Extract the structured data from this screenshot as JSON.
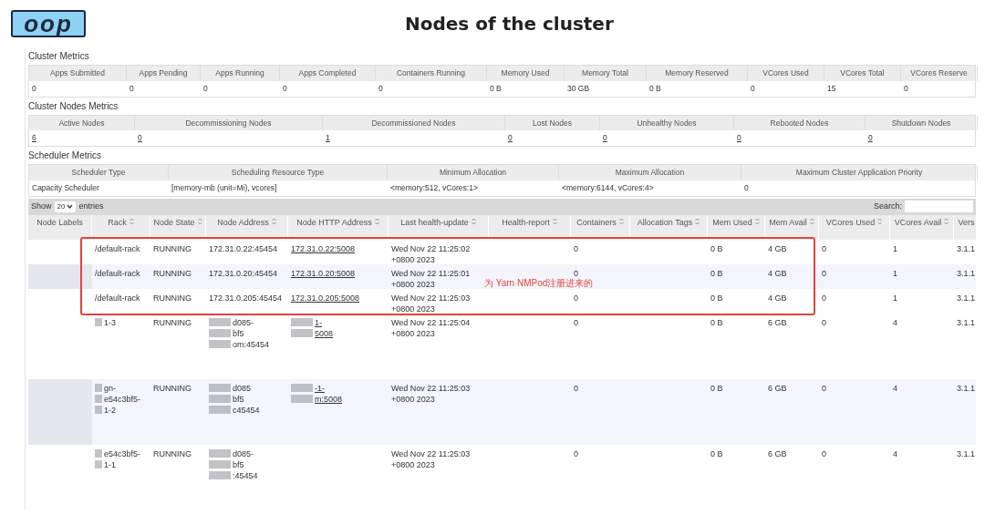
{
  "logo": {
    "text": "oop"
  },
  "title": "Nodes of the cluster",
  "sections": [
    {
      "title": "Cluster Metrics",
      "kind": "text",
      "columns": [
        "Apps Submitted",
        "Apps Pending",
        "Apps Running",
        "Apps Completed",
        "Containers Running",
        "Memory Used",
        "Memory Total",
        "Memory Reserved",
        "VCores Used",
        "VCores Total",
        "VCores Reserve"
      ],
      "values": [
        "0",
        "0",
        "0",
        "0",
        "0",
        "0 B",
        "30 GB",
        "0 B",
        "0",
        "15",
        "0"
      ]
    },
    {
      "title": "Cluster Nodes Metrics",
      "kind": "link",
      "columns": [
        "Active Nodes",
        "Decommissioning Nodes",
        "Decommissioned Nodes",
        "Lost Nodes",
        "Unhealthy Nodes",
        "Rebooted Nodes",
        "Shutdown Nodes"
      ],
      "values": [
        "6",
        "0",
        "1",
        "0",
        "0",
        "0",
        "0"
      ]
    },
    {
      "title": "Scheduler Metrics",
      "kind": "text",
      "columns": [
        "Scheduler Type",
        "Scheduling Resource Type",
        "Minimum Allocation",
        "Maximum Allocation",
        "Maximum Cluster Application Priority"
      ],
      "values": [
        "Capacity Scheduler",
        "[memory-mb (unit=Mi), vcores]",
        "<memory:512, vCores:1>",
        "<memory:6144, vCores:4>",
        "0"
      ]
    }
  ],
  "length_control": {
    "before": "Show",
    "value": "20",
    "after": "entries"
  },
  "search": {
    "label": "Search:"
  },
  "table": {
    "columns": [
      {
        "label": "Node Labels",
        "sortable": false
      },
      {
        "label": "Rack",
        "sortable": true
      },
      {
        "label": "Node State",
        "sortable": true
      },
      {
        "label": "Node Address",
        "sortable": true
      },
      {
        "label": "Node HTTP Address",
        "sortable": true
      },
      {
        "label": "Last health-update",
        "sortable": true
      },
      {
        "label": "Health-report",
        "sortable": true
      },
      {
        "label": "Containers",
        "sortable": true
      },
      {
        "label": "Allocation Tags",
        "sortable": true
      },
      {
        "label": "Mem Used",
        "sortable": true
      },
      {
        "label": "Mem Avail",
        "sortable": true
      },
      {
        "label": "VCores Used",
        "sortable": true
      },
      {
        "label": "VCores Avail",
        "sortable": true
      },
      {
        "label": "Vers",
        "sortable": false
      }
    ],
    "rows": [
      {
        "rack": "/default-rack",
        "state": "RUNNING",
        "address": "172.31.0.22:45454",
        "http": "172.31.0.22:5008",
        "update": "Wed Nov 22 11:25:02 +0800 2023",
        "containers": "0",
        "mem_used": "0 B",
        "mem_avail": "4 GB",
        "vcores_used": "0",
        "vcores_avail": "1",
        "version": "3.1.1"
      },
      {
        "rack": "/default-rack",
        "state": "RUNNING",
        "address": "172.31.0.20:45454",
        "http": "172.31.0.20:5008",
        "update": "Wed Nov 22 11:25:01 +0800 2023",
        "containers": "0",
        "mem_used": "0 B",
        "mem_avail": "4 GB",
        "vcores_used": "0",
        "vcores_avail": "1",
        "version": "3.1.1"
      },
      {
        "rack": "/default-rack",
        "state": "RUNNING",
        "address": "172.31.0.205:45454",
        "http": "172.31.0.205:5008",
        "update": "Wed Nov 22 11:25:03 +0800 2023",
        "containers": "0",
        "mem_used": "0 B",
        "mem_avail": "4 GB",
        "vcores_used": "0",
        "vcores_avail": "1",
        "version": "3.1.1"
      },
      {
        "rack": [
          "1-3"
        ],
        "state": "RUNNING",
        "address": [
          "d085-",
          "bf5",
          "om:45454"
        ],
        "http": [
          "1-",
          "5008"
        ],
        "update": "Wed Nov 22 11:25:04 +0800 2023",
        "containers": "0",
        "mem_used": "0 B",
        "mem_avail": "6 GB",
        "vcores_used": "0",
        "vcores_avail": "4",
        "version": "3.1.1"
      },
      {
        "rack": [
          "gn-",
          "e54c3bf5-",
          "1-2"
        ],
        "state": "RUNNING",
        "address": [
          "d085",
          "bf5",
          "c45454"
        ],
        "http": [
          "-1-",
          "m:5008"
        ],
        "update": "Wed Nov 22 11:25:03 +0800 2023",
        "containers": "0",
        "mem_used": "0 B",
        "mem_avail": "6 GB",
        "vcores_used": "0",
        "vcores_avail": "4",
        "version": "3.1.1"
      },
      {
        "rack": [
          "e54c3bf5-",
          "1-1"
        ],
        "state": "RUNNING",
        "address": [
          "d085-",
          "bf5",
          ":45454"
        ],
        "update": "Wed Nov 22 11:25:03 +0800 2023",
        "containers": "0",
        "mem_used": "0 B",
        "mem_avail": "6 GB",
        "vcores_used": "0",
        "vcores_avail": "4",
        "version": "3.1.1"
      }
    ]
  },
  "annotation": {
    "text": "为 Yarn NMPod注册进来的"
  }
}
